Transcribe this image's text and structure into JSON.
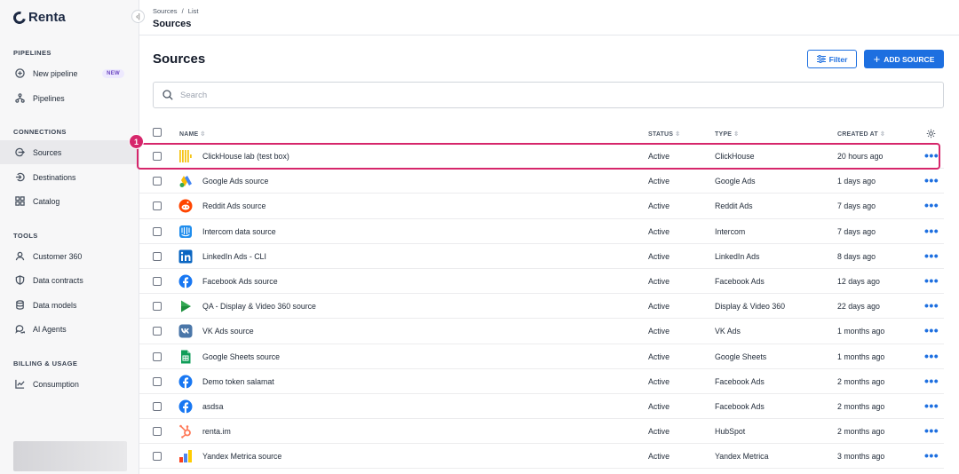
{
  "app": {
    "name": "Renta"
  },
  "sidebar": {
    "sections": [
      {
        "title": "PIPELINES",
        "items": [
          {
            "label": "New pipeline",
            "icon": "plus-circle-icon",
            "badge": "NEW"
          },
          {
            "label": "Pipelines",
            "icon": "pipelines-icon"
          }
        ]
      },
      {
        "title": "CONNECTIONS",
        "items": [
          {
            "label": "Sources",
            "icon": "sources-icon",
            "active": true
          },
          {
            "label": "Destinations",
            "icon": "destinations-icon"
          },
          {
            "label": "Catalog",
            "icon": "catalog-icon"
          }
        ]
      },
      {
        "title": "TOOLS",
        "items": [
          {
            "label": "Customer 360",
            "icon": "user-icon"
          },
          {
            "label": "Data contracts",
            "icon": "shield-icon"
          },
          {
            "label": "Data models",
            "icon": "database-icon"
          },
          {
            "label": "AI Agents",
            "icon": "chat-icon"
          }
        ]
      },
      {
        "title": "BILLING & USAGE",
        "items": [
          {
            "label": "Consumption",
            "icon": "chart-icon"
          }
        ]
      }
    ]
  },
  "header": {
    "breadcrumb_1": "Sources",
    "breadcrumb_sep": "/",
    "breadcrumb_2": "List",
    "title": "Sources"
  },
  "main": {
    "title": "Sources",
    "filter_label": "Filter",
    "add_label": "ADD SOURCE",
    "search_placeholder": "Search"
  },
  "table": {
    "columns": {
      "name": "NAME",
      "status": "STATUS",
      "type": "TYPE",
      "created": "CREATED AT"
    },
    "rows": [
      {
        "name": "ClickHouse lab (test box)",
        "status": "Active",
        "type": "ClickHouse",
        "created": "20 hours ago",
        "icon": "clickhouse"
      },
      {
        "name": "Google Ads source",
        "status": "Active",
        "type": "Google Ads",
        "created": "1 days ago",
        "icon": "google-ads"
      },
      {
        "name": "Reddit Ads source",
        "status": "Active",
        "type": "Reddit Ads",
        "created": "7 days ago",
        "icon": "reddit"
      },
      {
        "name": "Intercom data source",
        "status": "Active",
        "type": "Intercom",
        "created": "7 days ago",
        "icon": "intercom"
      },
      {
        "name": "LinkedIn Ads - CLI",
        "status": "Active",
        "type": "LinkedIn Ads",
        "created": "8 days ago",
        "icon": "linkedin"
      },
      {
        "name": "Facebook Ads source",
        "status": "Active",
        "type": "Facebook Ads",
        "created": "12 days ago",
        "icon": "facebook"
      },
      {
        "name": "QA - Display & Video 360 source",
        "status": "Active",
        "type": "Display & Video 360",
        "created": "22 days ago",
        "icon": "dv360"
      },
      {
        "name": "VK Ads source",
        "status": "Active",
        "type": "VK Ads",
        "created": "1 months ago",
        "icon": "vk"
      },
      {
        "name": "Google Sheets source",
        "status": "Active",
        "type": "Google Sheets",
        "created": "1 months ago",
        "icon": "sheets"
      },
      {
        "name": "Demo token salamat",
        "status": "Active",
        "type": "Facebook Ads",
        "created": "2 months ago",
        "icon": "facebook"
      },
      {
        "name": "asdsa",
        "status": "Active",
        "type": "Facebook Ads",
        "created": "2 months ago",
        "icon": "facebook"
      },
      {
        "name": "renta.im",
        "status": "Active",
        "type": "HubSpot",
        "created": "2 months ago",
        "icon": "hubspot"
      },
      {
        "name": "Yandex Metrica source",
        "status": "Active",
        "type": "Yandex Metrica",
        "created": "3 months ago",
        "icon": "yandex"
      }
    ]
  },
  "annotation": {
    "marker": "1"
  },
  "colors": {
    "accent": "#1d6fe0",
    "highlight": "#d6266b"
  }
}
